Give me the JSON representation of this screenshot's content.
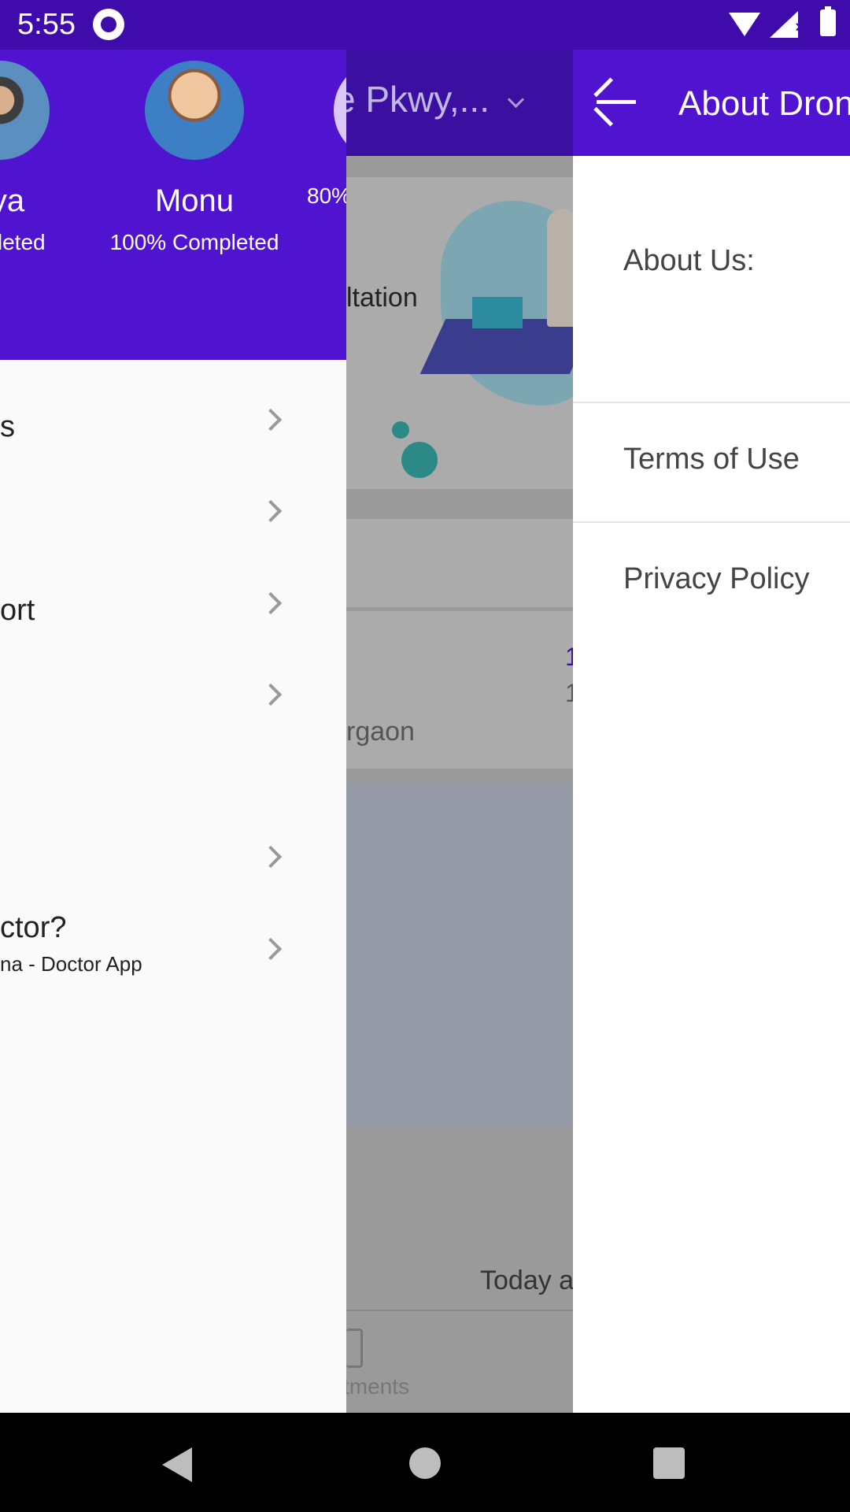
{
  "status_bar": {
    "time": "5:55"
  },
  "drawer": {
    "members": [
      {
        "name": "fiya",
        "progress": "ompleted"
      },
      {
        "name": "Monu",
        "progress": "100% Completed"
      },
      {
        "name": "",
        "progress": "80%"
      }
    ],
    "menu_items": [
      {
        "label": "s",
        "sublabel": ""
      },
      {
        "label": "",
        "sublabel": ""
      },
      {
        "label": "ort",
        "sublabel": ""
      },
      {
        "label": "",
        "sublabel": ""
      },
      {
        "label": "",
        "sublabel": ""
      },
      {
        "label": "ctor?",
        "sublabel": "na - Doctor App"
      }
    ]
  },
  "background": {
    "location": "e Pkwy,...",
    "consult_text": "ltation",
    "city_text": "rgaon",
    "num1": "1",
    "num2": "1",
    "today_text": "Today a",
    "nav_label": "tments"
  },
  "about": {
    "title": "About Dron",
    "rows": [
      "About Us:",
      "Terms of Use",
      "Privacy Policy"
    ]
  },
  "colors": {
    "primary": "#5014d0",
    "status_bar": "#3f0bab"
  },
  "icons": [
    "app-logo-icon",
    "wifi-icon",
    "signal-icon",
    "battery-icon",
    "chevron-right-icon",
    "back-arrow-icon",
    "calendar-icon",
    "nav-back-icon",
    "nav-home-icon",
    "nav-recents-icon"
  ]
}
